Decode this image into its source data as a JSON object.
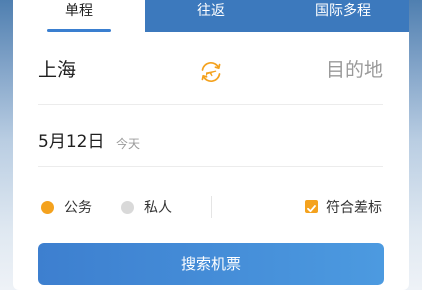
{
  "tabs": [
    {
      "label": "单程",
      "active": true
    },
    {
      "label": "往返",
      "active": false
    },
    {
      "label": "国际多程",
      "active": false
    }
  ],
  "route": {
    "from": "上海",
    "to": "目的地",
    "swap_icon": "swap-plane-icon"
  },
  "date": {
    "value": "5月12日",
    "sub": "今天"
  },
  "travel_type": {
    "options": [
      {
        "label": "公务",
        "selected": true
      },
      {
        "label": "私人",
        "selected": false
      }
    ]
  },
  "policy": {
    "label": "符合差标",
    "checked": true
  },
  "search_button": {
    "label": "搜索机票"
  },
  "colors": {
    "accent": "#f4a21e",
    "primary": "#3d7fcf",
    "tab_bg": "#3c79bd"
  }
}
